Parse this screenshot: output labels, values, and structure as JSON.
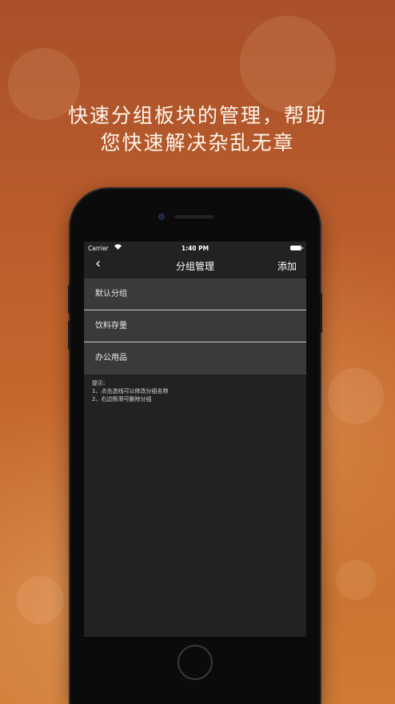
{
  "headline": {
    "line1": "快速分组板块的管理，帮助",
    "line2": "您快速解决杂乱无章"
  },
  "status_bar": {
    "carrier": "Carrier",
    "wifi_icon": "wifi-icon",
    "time": "1:40 PM",
    "battery_icon": "battery-icon"
  },
  "navbar": {
    "back_icon": "chevron-left-icon",
    "back_glyph": "‹",
    "title": "分组管理",
    "add_label": "添加"
  },
  "groups": [
    {
      "label": "默认分组"
    },
    {
      "label": "饮料存量"
    },
    {
      "label": "办公用品"
    }
  ],
  "tips": {
    "title": "提示:",
    "line1": "1、点击选线可以修改分组名称",
    "line2": "2、右边侧滑可删除分组"
  }
}
